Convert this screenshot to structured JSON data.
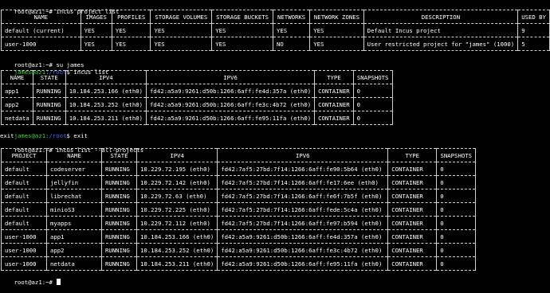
{
  "terminal": {
    "prompt_root": "root@az1:~#",
    "prompt_user": "james@az1:",
    "prompt_user_path": "/root",
    "prompt_user_symbol": "$",
    "cmd1": "incus project list",
    "cmd2": "su james",
    "cmd3": "incus list",
    "cmd4": "exit",
    "exit_output": "exit",
    "cmd5": "incus list --all-projects"
  },
  "project_table": {
    "headers": [
      "NAME",
      "IMAGES",
      "PROFILES",
      "STORAGE VOLUMES",
      "STORAGE BUCKETS",
      "NETWORKS",
      "NETWORK ZONES",
      "DESCRIPTION",
      "USED BY"
    ],
    "rows": [
      [
        "default (current)",
        "YES",
        "YES",
        "YES",
        "YES",
        "YES",
        "YES",
        "Default Incus project",
        "9"
      ],
      [
        "user-1000",
        "YES",
        "YES",
        "YES",
        "YES",
        "NO",
        "YES",
        "User restricted project for \"james\" (1000)",
        "5"
      ]
    ]
  },
  "user_table": {
    "headers": [
      "NAME",
      "STATE",
      "IPV4",
      "IPV6",
      "TYPE",
      "SNAPSHOTS"
    ],
    "rows": [
      [
        "app1",
        "RUNNING",
        "10.184.253.166 (eth0)",
        "fd42:a5a9:9261:d50b:1266:6aff:fe4d:357a (eth0)",
        "CONTAINER",
        "0"
      ],
      [
        "app2",
        "RUNNING",
        "10.184.253.252 (eth0)",
        "fd42:a5a9:9261:d50b:1266:6aff:fe3c:4b72 (eth0)",
        "CONTAINER",
        "0"
      ],
      [
        "netdata",
        "RUNNING",
        "10.184.253.211 (eth0)",
        "fd42:a5a9:9261:d50b:1266:6aff:fe95:11fa (eth0)",
        "CONTAINER",
        "0"
      ]
    ]
  },
  "all_table": {
    "headers": [
      "PROJECT",
      "NAME",
      "STATE",
      "IPV4",
      "IPV6",
      "TYPE",
      "SNAPSHOTS"
    ],
    "rows": [
      [
        "default",
        "codeserver",
        "RUNNING",
        "10.229.72.195 (eth0)",
        "fd42:7af5:27bd:7f14:1266:6aff:fe90:5b64 (eth0)",
        "CONTAINER",
        "0"
      ],
      [
        "default",
        "jellyfin",
        "RUNNING",
        "10.229.72.142 (eth0)",
        "fd42:7af5:27bd:7f14:1266:6aff:fe17:6ee (eth0)",
        "CONTAINER",
        "0"
      ],
      [
        "default",
        "librechat",
        "RUNNING",
        "10.229.72.63 (eth0)",
        "fd42:7af5:27bd:7f14:1266:6aff:fe6f:7b5f (eth0)",
        "CONTAINER",
        "0"
      ],
      [
        "default",
        "minioS3",
        "RUNNING",
        "10.229.72.225 (eth0)",
        "fd42:7af5:27bd:7f14:1266:6aff:fede:5c4a (eth0)",
        "CONTAINER",
        "0"
      ],
      [
        "default",
        "myapps",
        "RUNNING",
        "10.229.72.112 (eth0)",
        "fd42:7af5:27bd:7f14:1266:6aff:fe97:b594 (eth0)",
        "CONTAINER",
        "0"
      ],
      [
        "user-1000",
        "app1",
        "RUNNING",
        "10.184.253.166 (eth0)",
        "fd42:a5a9:9261:d50b:1266:6aff:fe4d:357a (eth0)",
        "CONTAINER",
        "0"
      ],
      [
        "user-1000",
        "app2",
        "RUNNING",
        "10.184.253.252 (eth0)",
        "fd42:a5a9:9261:d50b:1266:6aff:fe3c:4b72 (eth0)",
        "CONTAINER",
        "0"
      ],
      [
        "user-1000",
        "netdata",
        "RUNNING",
        "10.184.253.211 (eth0)",
        "fd42:a5a9:9261:d50b:1266:6aff:fe95:11fa (eth0)",
        "CONTAINER",
        "0"
      ]
    ]
  },
  "colors": {
    "background": "#000000",
    "text": "#ffffff",
    "user": "#3fd63f",
    "path": "#4a6bff",
    "border": "#cfcfcf"
  }
}
